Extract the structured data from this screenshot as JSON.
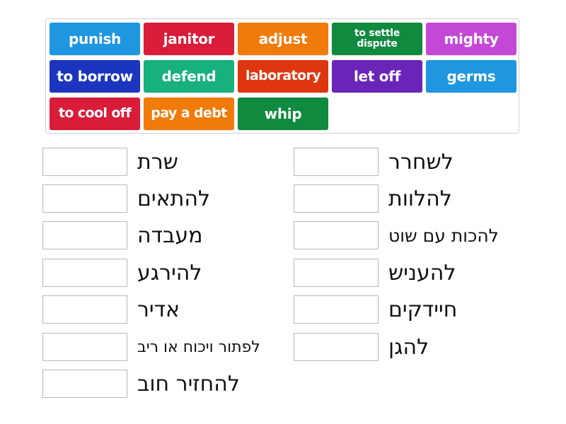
{
  "word_bank": {
    "tiles": [
      {
        "label": "punish",
        "color": "#1e96e0"
      },
      {
        "label": "janitor",
        "color": "#d91c3a"
      },
      {
        "label": "adjust",
        "color": "#f07a0a"
      },
      {
        "label": "to settle dispute",
        "color": "#0f8a3e"
      },
      {
        "label": "mighty",
        "color": "#c448d6"
      },
      {
        "label": "to borrow",
        "color": "#1c35bf"
      },
      {
        "label": "defend",
        "color": "#17b07f"
      },
      {
        "label": "laboratory",
        "color": "#e0360f"
      },
      {
        "label": "let off",
        "color": "#6a25b8"
      },
      {
        "label": "germs",
        "color": "#1e96e0"
      },
      {
        "label": "to cool off",
        "color": "#d91c3a"
      },
      {
        "label": "pay a debt",
        "color": "#f07a0a"
      },
      {
        "label": "whip",
        "color": "#0f8a3e"
      }
    ]
  },
  "clues": {
    "left": [
      {
        "text": "שרת"
      },
      {
        "text": "להתאים"
      },
      {
        "text": "מעבדה"
      },
      {
        "text": "להירגע"
      },
      {
        "text": "אדיר"
      },
      {
        "text": "לפתור ויכוח או ריב"
      },
      {
        "text": "להחזיר חוב"
      }
    ],
    "right": [
      {
        "text": "לשחרר"
      },
      {
        "text": "להלוות"
      },
      {
        "text": "להכות עם שוט"
      },
      {
        "text": "להעניש"
      },
      {
        "text": "חיידקים"
      },
      {
        "text": "להגן"
      }
    ]
  }
}
